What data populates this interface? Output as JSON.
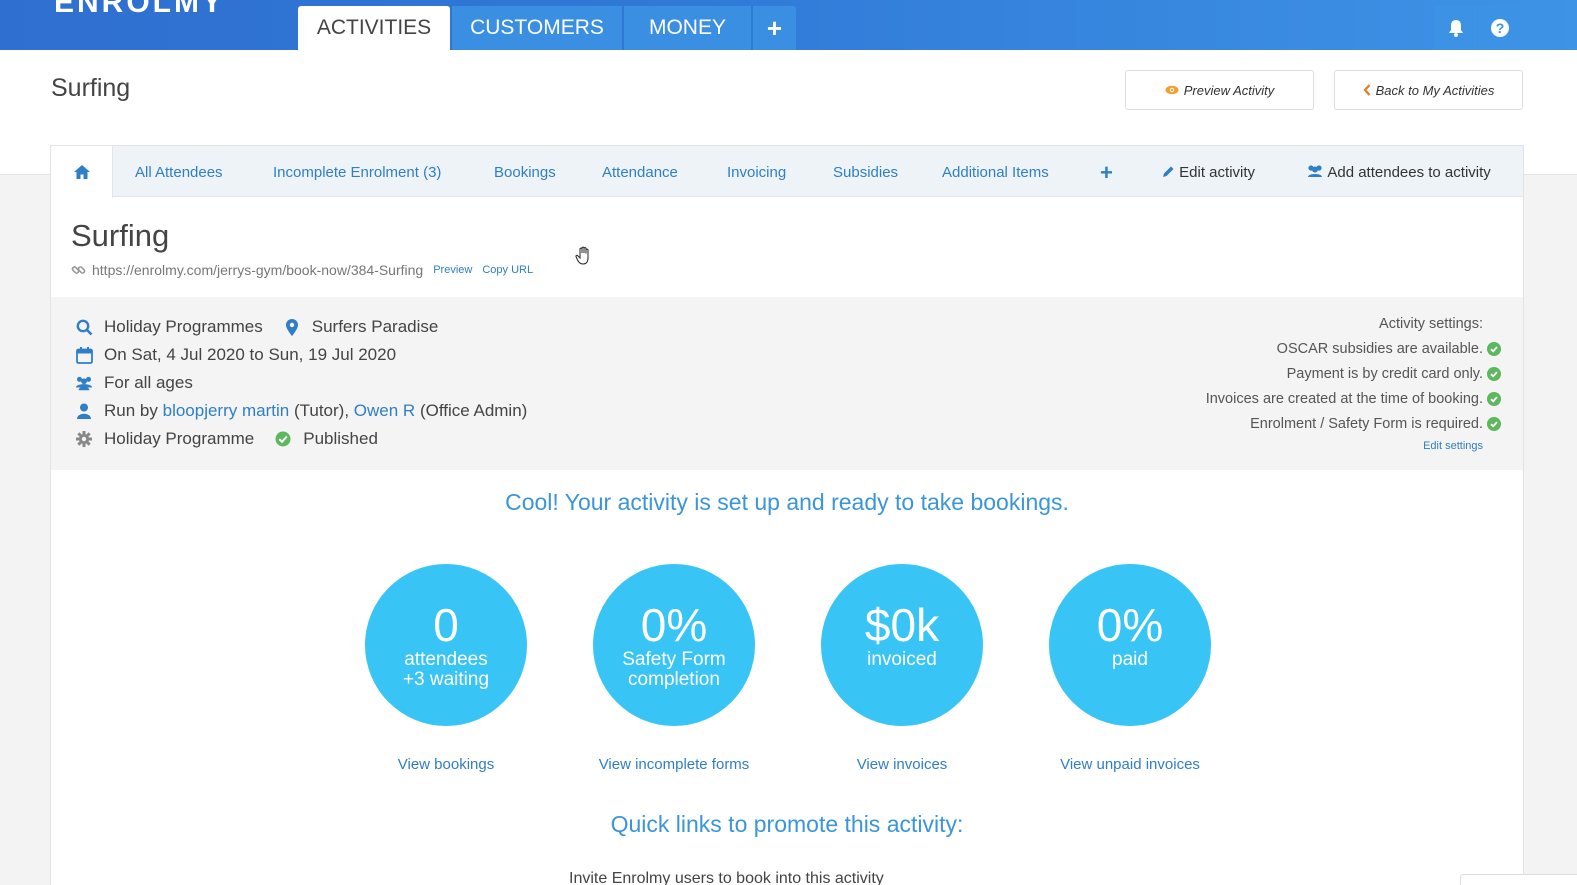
{
  "brand": {
    "logo": "ENROLMY"
  },
  "topnav": {
    "tabs": [
      {
        "label": "ACTIVITIES"
      },
      {
        "label": "CUSTOMERS"
      },
      {
        "label": "MONEY"
      },
      {
        "label": "+"
      }
    ]
  },
  "header": {
    "title": "Surfing",
    "preview_label": "Preview Activity",
    "back_label": "Back to My Activities"
  },
  "subnav": {
    "items": [
      {
        "label": "All Attendees"
      },
      {
        "label": "Incomplete Enrolment (3)"
      },
      {
        "label": "Bookings"
      },
      {
        "label": "Attendance"
      },
      {
        "label": "Invoicing"
      },
      {
        "label": "Subsidies"
      },
      {
        "label": "Additional Items"
      },
      {
        "label": "+"
      },
      {
        "label": "Edit activity"
      },
      {
        "label": "Add attendees to activity"
      }
    ]
  },
  "activity": {
    "title": "Surfing",
    "url": "https://enrolmy.com/jerrys-gym/book-now/384-Surfing",
    "preview_link": "Preview",
    "copy_link": "Copy URL",
    "category": "Holiday Programmes",
    "location": "Surfers Paradise",
    "dates": "On Sat, 4 Jul 2020 to Sun, 19 Jul 2020",
    "ages": "For all ages",
    "run_by_prefix": "Run by",
    "tutor_name": "bloopjerry martin",
    "tutor_role": "(Tutor),",
    "admin_name": "Owen R",
    "admin_role": "(Office Admin)",
    "type": "Holiday Programme",
    "status": "Published"
  },
  "settings": {
    "heading": "Activity settings:",
    "items": [
      "OSCAR subsidies are available.",
      "Payment is by credit card only.",
      "Invoices are created at the time of booking.",
      "Enrolment / Safety Form is required."
    ],
    "edit_link": "Edit settings"
  },
  "ready_message": "Cool! Your activity is set up and ready to take bookings.",
  "stats": [
    {
      "value": "0",
      "line1": "attendees",
      "line2": "+3 waiting",
      "link": "View bookings"
    },
    {
      "value": "0%",
      "line1": "Safety Form",
      "line2": "completion",
      "link": "View incomplete forms"
    },
    {
      "value": "$0k",
      "line1": "invoiced",
      "line2": "",
      "link": "View invoices"
    },
    {
      "value": "0%",
      "line1": "paid",
      "line2": "",
      "link": "View unpaid invoices"
    }
  ],
  "promote_heading": "Quick links to promote this activity:",
  "promote_cutoff": "Invite Enrolmy users to book into this activity",
  "colors": {
    "header_blue": "#2f78d6",
    "circle": "#38c5f5",
    "link": "#2f7fc6",
    "check": "#5cb85c"
  }
}
